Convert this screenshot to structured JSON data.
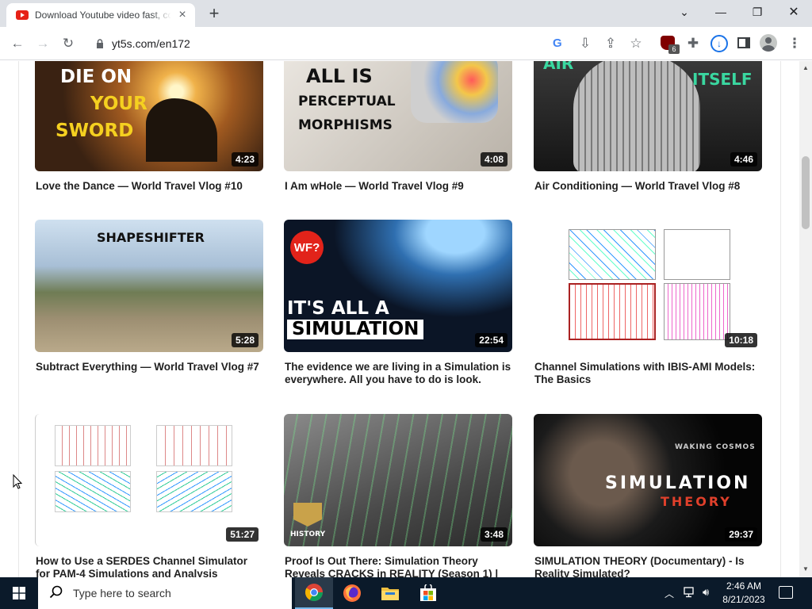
{
  "browser": {
    "tab_title": "Download Youtube video fast, co",
    "tab_close_icon": "close-icon",
    "new_tab_icon": "plus-icon",
    "url": "yt5s.com/en172",
    "ublock_badge": "6",
    "window_controls": {
      "tabsearch": "⌄",
      "minimize": "—",
      "restore": "❐",
      "close": "✕"
    }
  },
  "toolbar_icons": {
    "back": "←",
    "forward": "→",
    "reload": "↻",
    "menu": "⋮",
    "google": "G",
    "install": "⇩",
    "share": "⇪",
    "star": "☆",
    "extensions": "✚"
  },
  "videos": [
    {
      "title": "Love the Dance — World Travel Vlog #10",
      "duration": "4:23",
      "thumb_text": [
        "DIE ON",
        "YOUR",
        "SWORD"
      ]
    },
    {
      "title": "I Am wHole — World Travel Vlog #9",
      "duration": "4:08",
      "thumb_text": [
        "ALL IS",
        "PERCEPTUAL",
        "MORPHISMS"
      ]
    },
    {
      "title": "Air Conditioning — World Travel Vlog #8",
      "duration": "4:46",
      "thumb_text": [
        "AIR",
        "ITSELF"
      ]
    },
    {
      "title": "Subtract Everything — World Travel Vlog #7",
      "duration": "5:28",
      "thumb_text": [
        "SHAPESHIFTER"
      ]
    },
    {
      "title": "The evidence we are living in a Simulation is everywhere. All you have to do is look.",
      "duration": "22:54",
      "thumb_text": [
        "WF?",
        "IT'S ALL A",
        "SIMULATION"
      ]
    },
    {
      "title": "Channel Simulations with IBIS-AMI Models: The Basics",
      "duration": "10:18",
      "thumb_text": []
    },
    {
      "title": "How to Use a SERDES Channel Simulator for PAM-4 Simulations and Analysis",
      "duration": "51:27",
      "thumb_text": []
    },
    {
      "title": "Proof Is Out There: Simulation Theory Reveals CRACKS in REALITY (Season 1) |",
      "duration": "3:48",
      "thumb_text": [
        "HISTORY"
      ]
    },
    {
      "title": "SIMULATION THEORY (Documentary) - Is Reality Simulated?",
      "duration": "29:37",
      "thumb_text": [
        "WAKING COSMOS",
        "SIMULATION",
        "THEORY"
      ]
    }
  ],
  "taskbar": {
    "search_placeholder": "Type here to search",
    "time": "2:46 AM",
    "date": "8/21/2023"
  },
  "colors": {
    "accent": "#1a73e8",
    "taskbar": "#0b1a2a",
    "youtube_red": "#e62117"
  }
}
